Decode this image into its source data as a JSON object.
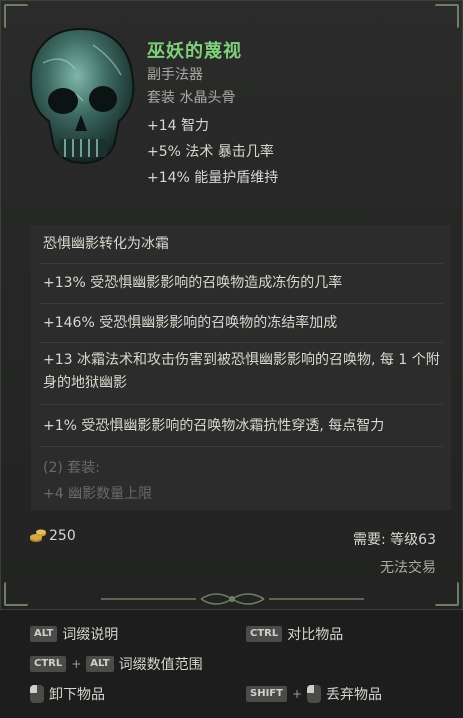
{
  "item": {
    "name": "巫妖的蔑视",
    "type": "副手法器",
    "set": "套装 水晶头骨",
    "base_stats": [
      "+14 智力",
      "+5% 法术 暴击几率",
      "+14% 能量护盾维持"
    ]
  },
  "affixes": [
    "恐惧幽影转化为冰霜",
    "+13% 受恐惧幽影影响的召唤物造成冻伤的几率",
    "+146% 受恐惧幽影影响的召唤物的冻结率加成",
    "+13 冰霜法术和攻击伤害到被恐惧幽影影响的召唤物, 每 1 个附身的地狱幽影",
    "+1% 受恐惧幽影影响的召唤物冰霜抗性穿透, 每点智力"
  ],
  "set_bonus": {
    "header": "(2) 套装:",
    "line": "+4 幽影数量上限"
  },
  "footer": {
    "gold": "250",
    "requirement_label": "需要: 等级",
    "requirement_level": "63",
    "trade_status": "无法交易"
  },
  "hotkeys": {
    "alt_key": "ALT",
    "ctrl_key": "CTRL",
    "shift_key": "SHIFT",
    "plus": "+",
    "affix_info": "词缀说明",
    "compare": "对比物品",
    "affix_ranges": "词缀数值范围",
    "unequip": "卸下物品",
    "drop": "丢弃物品"
  },
  "colors": {
    "unique_name": "#7ed07a",
    "text": "#d9d7cf",
    "muted": "#6a6b66",
    "panel_bg": "#2b2c2b"
  }
}
